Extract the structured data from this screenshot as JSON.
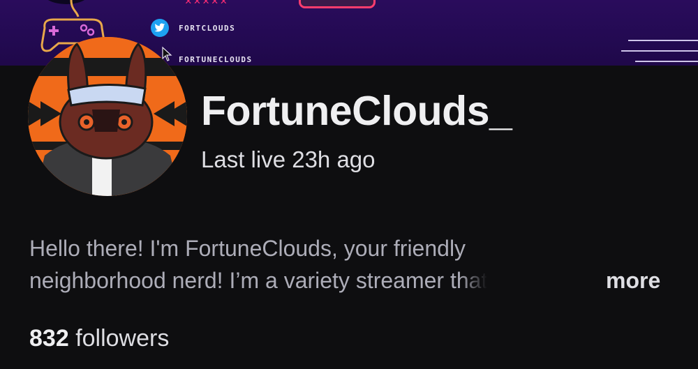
{
  "banner": {
    "x_marks": "✕✕✕✕✕",
    "socials": [
      {
        "icon": "twitter-icon",
        "handle": "FORTCLOUDS"
      },
      {
        "icon": "cursor-icon",
        "handle": "FORTUNECLOUDS"
      }
    ],
    "accent": "#ff2d75",
    "background": "#230a52"
  },
  "profile": {
    "channel_name": "FortuneClouds_",
    "last_live": "Last live 23h ago",
    "bio_line1": "Hello there! I'm FortuneClouds, your friendly",
    "bio_line2": "neighborhood nerd! I’m a variety streamer that",
    "more_label": "more",
    "followers_count": "832",
    "followers_label": "followers"
  },
  "colors": {
    "background": "#0e0e10",
    "text_primary": "#efeff1",
    "text_secondary": "#adadb8",
    "avatar_ring": "#f06a1a"
  }
}
